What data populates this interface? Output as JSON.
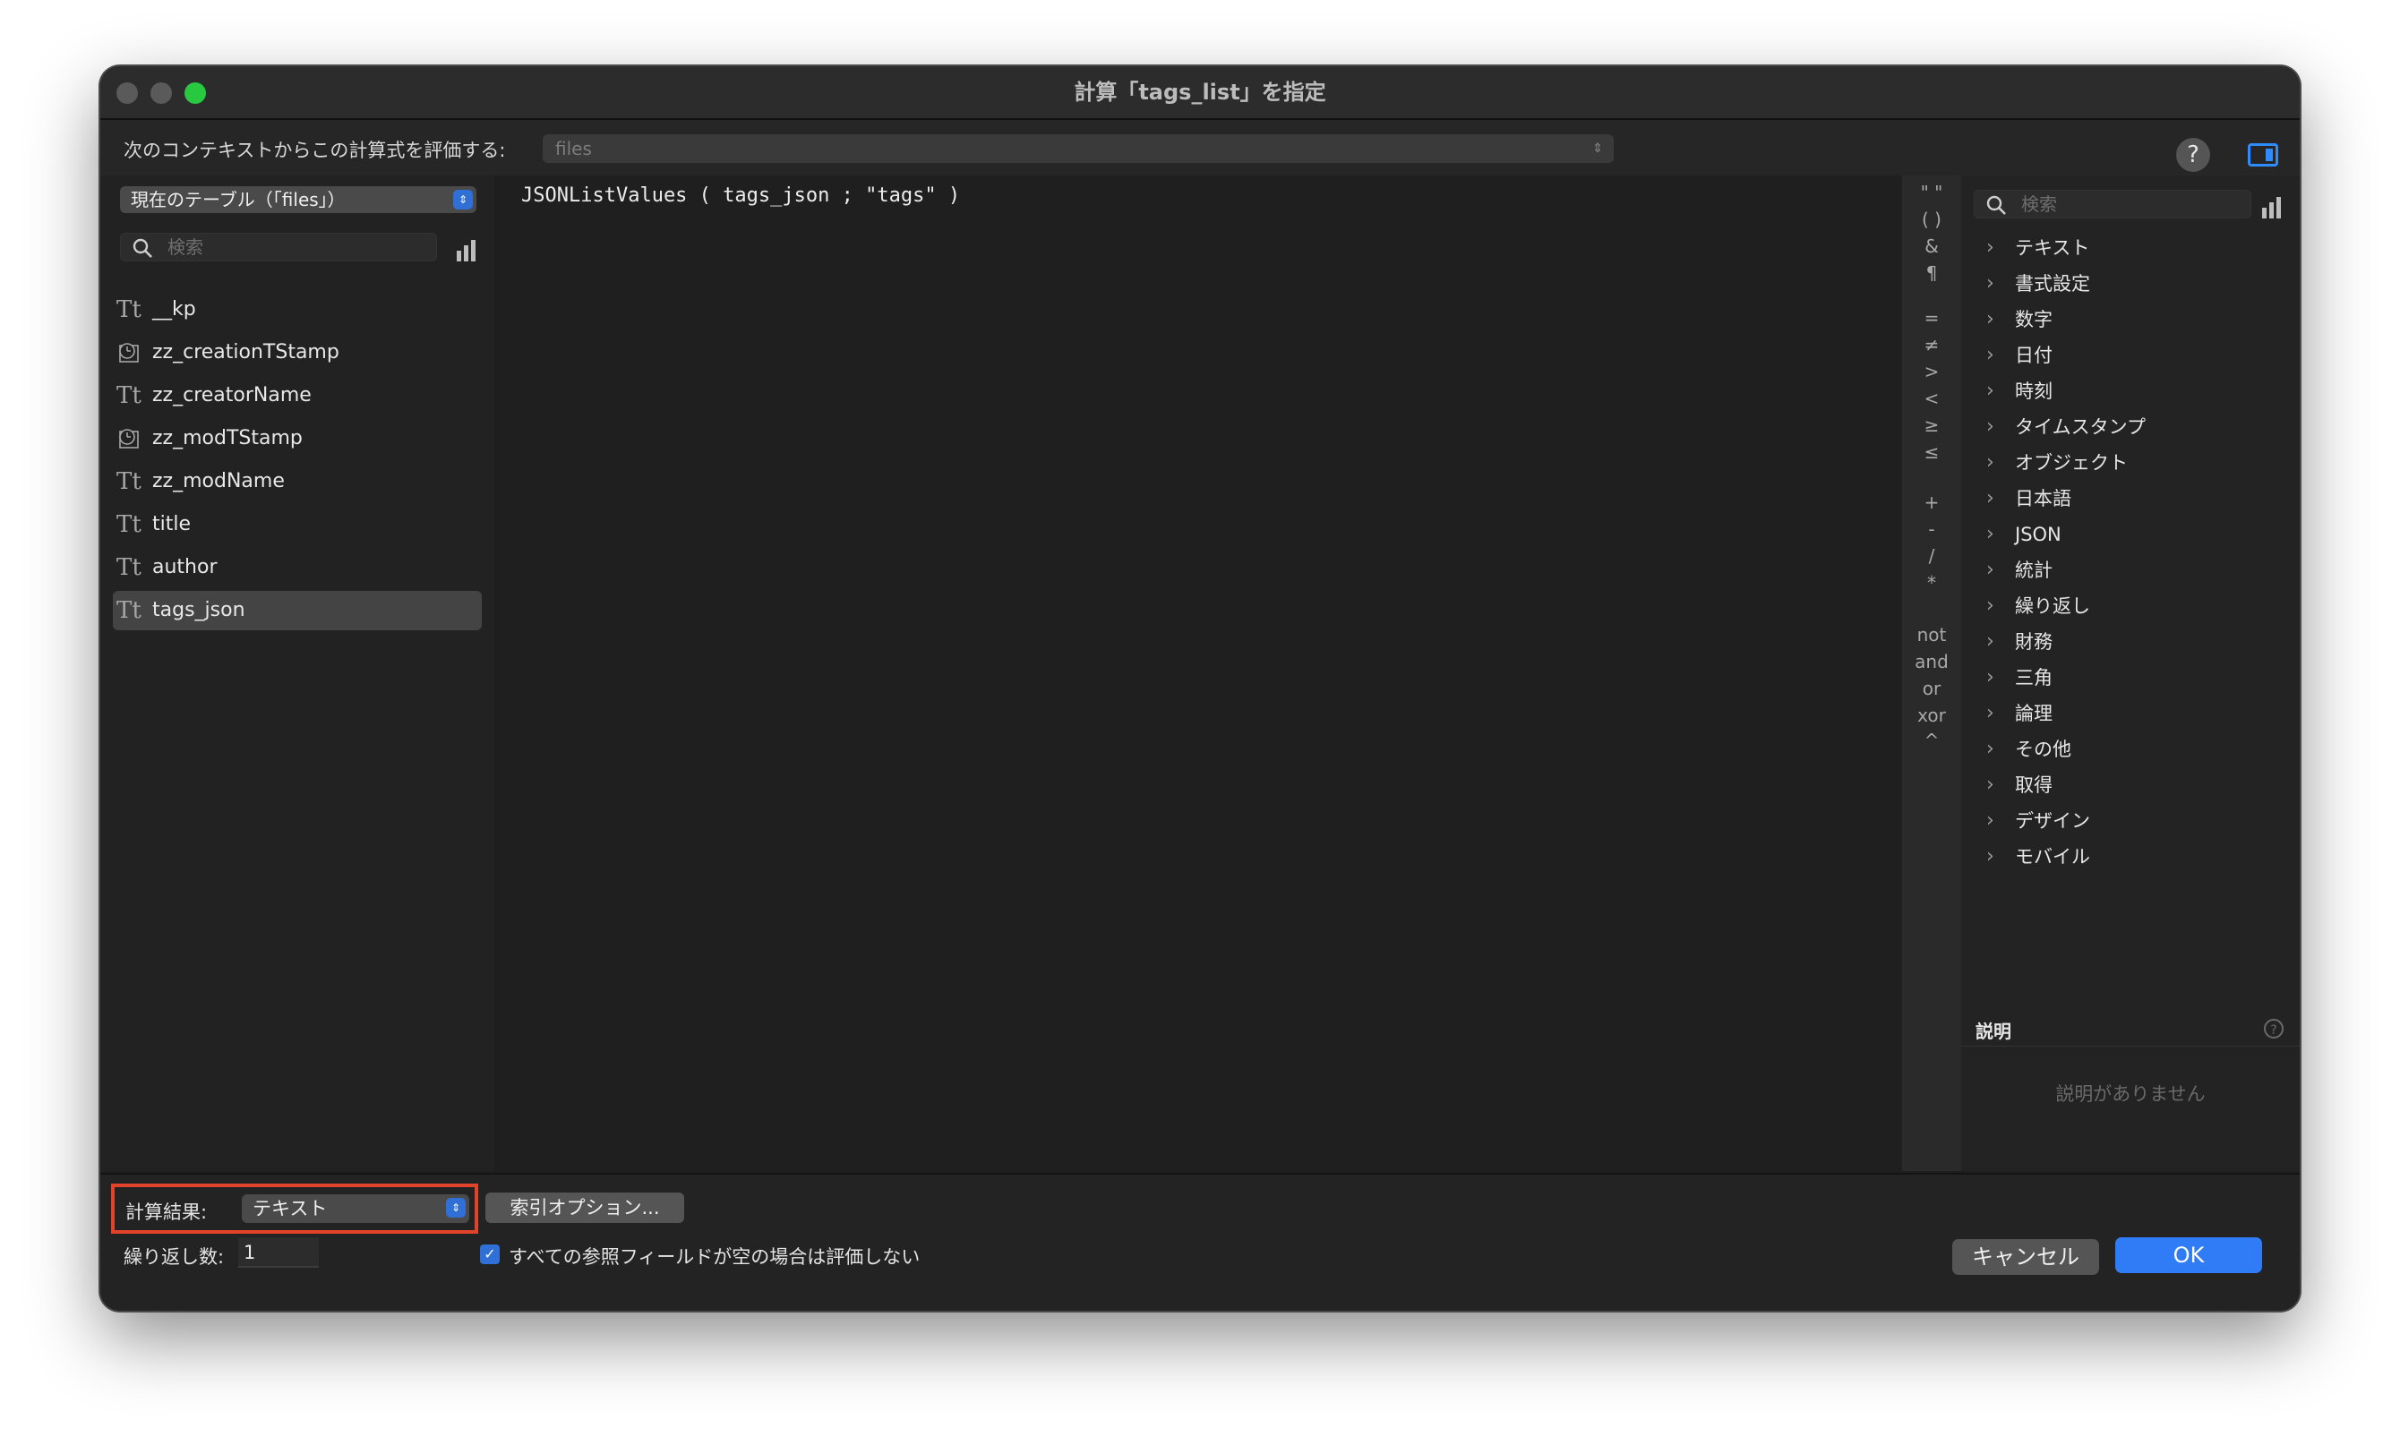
{
  "window": {
    "title": "計算「tags_list」を指定"
  },
  "context": {
    "label": "次のコンテキストからこの計算式を評価する:",
    "value": "files"
  },
  "left": {
    "table_select": "現在のテーブル（「files」）",
    "search_placeholder": "検索",
    "fields": [
      {
        "name": "__kp",
        "type": "text"
      },
      {
        "name": "zz_creationTStamp",
        "type": "timestamp"
      },
      {
        "name": "zz_creatorName",
        "type": "text"
      },
      {
        "name": "zz_modTStamp",
        "type": "timestamp"
      },
      {
        "name": "zz_modName",
        "type": "text"
      },
      {
        "name": "title",
        "type": "text"
      },
      {
        "name": "author",
        "type": "text"
      },
      {
        "name": "tags_json",
        "type": "text",
        "selected": true
      }
    ]
  },
  "editor": {
    "formula": "JSONListValues ( tags_json ; \"tags\" )"
  },
  "operators": [
    "\" \"",
    "( )",
    "&",
    "¶",
    "=",
    "≠",
    ">",
    "<",
    "≥",
    "≤",
    "+",
    "-",
    "/",
    "*",
    "not",
    "and",
    "or",
    "xor",
    "^"
  ],
  "functions": {
    "search_placeholder": "検索",
    "categories": [
      "テキスト",
      "書式設定",
      "数字",
      "日付",
      "時刻",
      "タイムスタンプ",
      "オブジェクト",
      "日本語",
      "JSON",
      "統計",
      "繰り返し",
      "財務",
      "三角",
      "論理",
      "その他",
      "取得",
      "デザイン",
      "モバイル"
    ],
    "description_title": "説明",
    "description_empty": "説明がありません"
  },
  "bottom": {
    "calc_result_label": "計算結果:",
    "calc_result_value": "テキスト",
    "index_options": "索引オプション...",
    "repetitions_label": "繰り返し数:",
    "repetitions_value": "1",
    "checkbox_label": "すべての参照フィールドが空の場合は評価しない",
    "cancel": "キャンセル",
    "ok": "OK"
  },
  "colors": {
    "accent": "#2f7cf6",
    "highlight_border": "#e0432a",
    "close_disabled": "#5a5a5a",
    "zoom": "#28c840"
  }
}
